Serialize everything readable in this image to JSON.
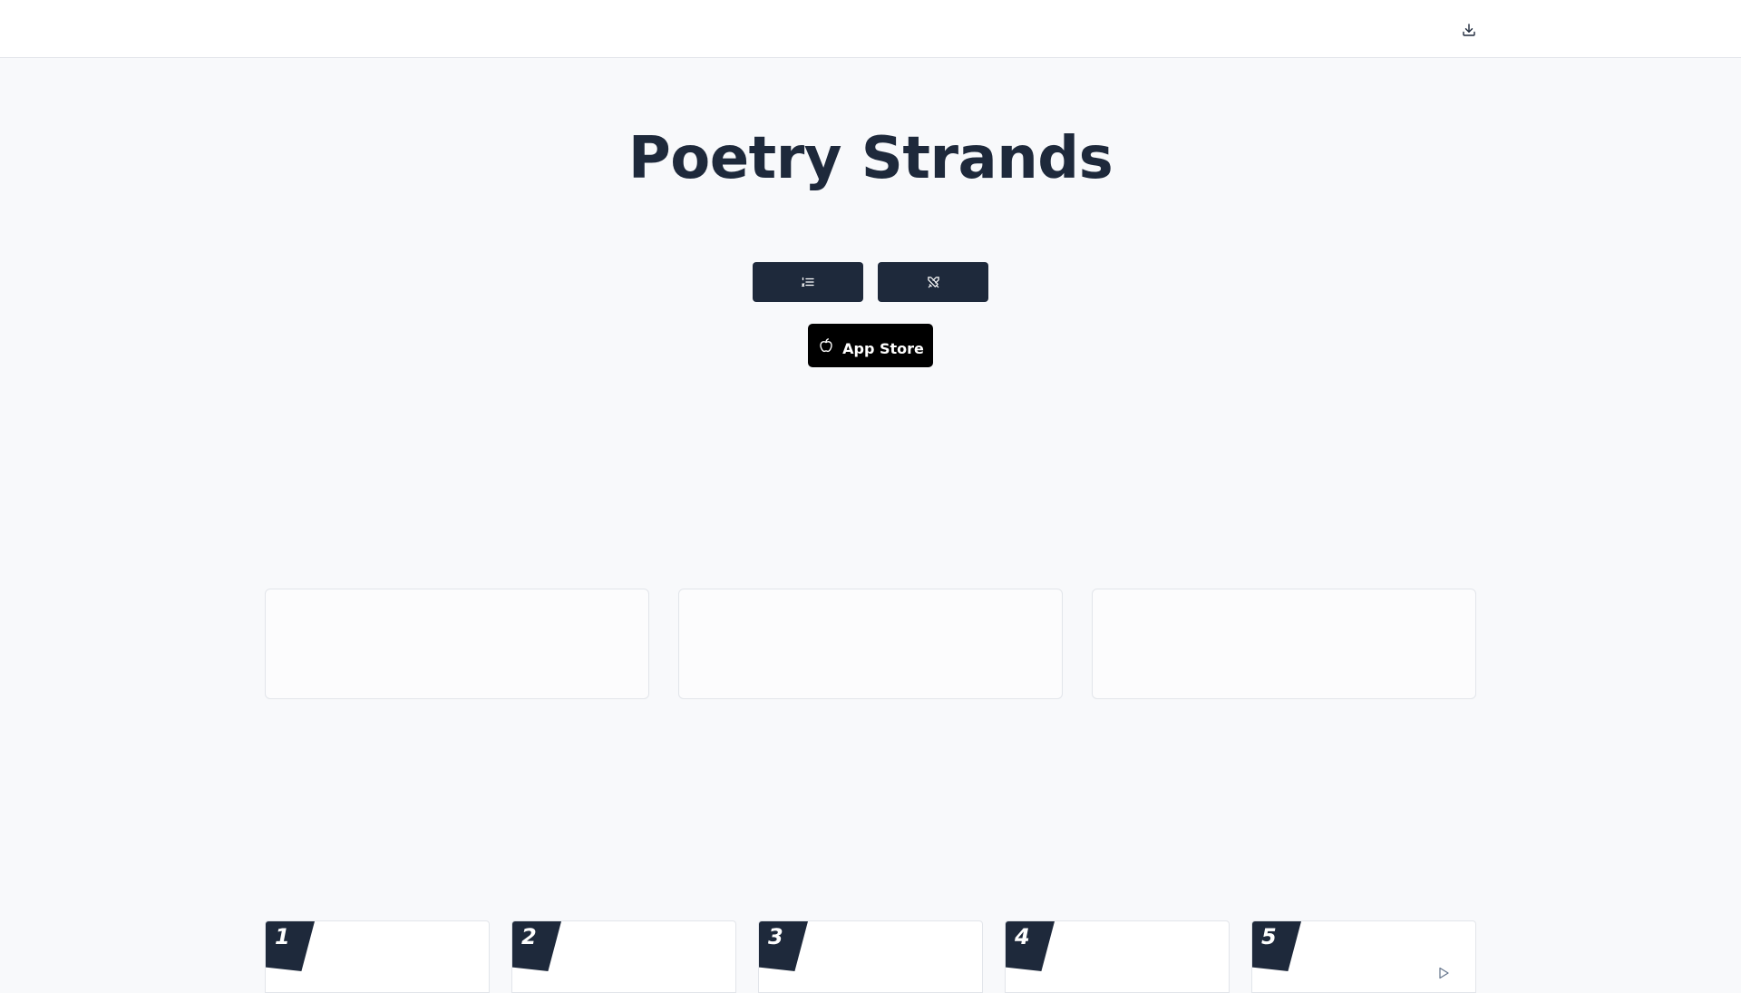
{
  "header": {
    "download_icon": "download-icon"
  },
  "hero": {
    "title": "Poetry Strands",
    "buttons": [
      {
        "icon": "list-icon"
      },
      {
        "icon": "swords-icon"
      }
    ],
    "app_store": {
      "label": "App Store",
      "icon": "apple-icon"
    }
  },
  "empty_cards": [
    "",
    "",
    ""
  ],
  "levels": [
    {
      "number": "1"
    },
    {
      "number": "2"
    },
    {
      "number": "3"
    },
    {
      "number": "4"
    },
    {
      "number": "5"
    }
  ],
  "colors": {
    "navy": "#1e293b",
    "background": "#f8f9fb",
    "border": "#e2e5ea",
    "app_store_bg": "#000000"
  }
}
